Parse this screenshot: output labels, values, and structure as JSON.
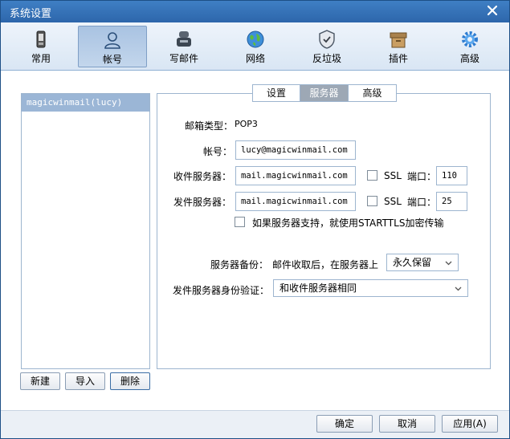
{
  "window": {
    "title": "系统设置"
  },
  "toolbar": {
    "items": [
      {
        "label": "常用",
        "icon": "phone-icon"
      },
      {
        "label": "帐号",
        "icon": "user-icon"
      },
      {
        "label": "写邮件",
        "icon": "compose-icon"
      },
      {
        "label": "网络",
        "icon": "globe-icon"
      },
      {
        "label": "反垃圾",
        "icon": "shield-icon"
      },
      {
        "label": "插件",
        "icon": "box-icon"
      },
      {
        "label": "高级",
        "icon": "gear-icon"
      }
    ],
    "active": "帐号"
  },
  "accounts": {
    "items": [
      "magicwinmail(lucy)"
    ]
  },
  "left_buttons": {
    "new": "新建",
    "import": "导入",
    "delete": "删除"
  },
  "tabs": {
    "items": [
      "设置",
      "服务器",
      "高级"
    ],
    "active": "服务器"
  },
  "form": {
    "mailbox_type_label": "邮箱类型：",
    "mailbox_type_value": "POP3",
    "account_label": "帐号：",
    "account_value": "lucy@magicwinmail.com",
    "incoming_label": "收件服务器：",
    "incoming_value": "mail.magicwinmail.com",
    "incoming_ssl": "SSL",
    "incoming_port_label": "端口：",
    "incoming_port": "110",
    "outgoing_label": "发件服务器：",
    "outgoing_value": "mail.magicwinmail.com",
    "outgoing_ssl": "SSL",
    "outgoing_port_label": "端口：",
    "outgoing_port": "25",
    "starttls_label": "如果服务器支持，就使用STARTTLS加密传输",
    "backup_label": "服务器备份：",
    "backup_desc": "邮件收取后，在服务器上",
    "backup_value": "永久保留",
    "auth_label": "发件服务器身份验证：",
    "auth_value": "和收件服务器相同"
  },
  "bottom": {
    "ok": "确定",
    "cancel": "取消",
    "apply": "应用(A)"
  },
  "colors": {
    "titlebar": "#2d66ab",
    "active_tab": "#9da8b5",
    "selected_account": "#9bb6d6"
  }
}
